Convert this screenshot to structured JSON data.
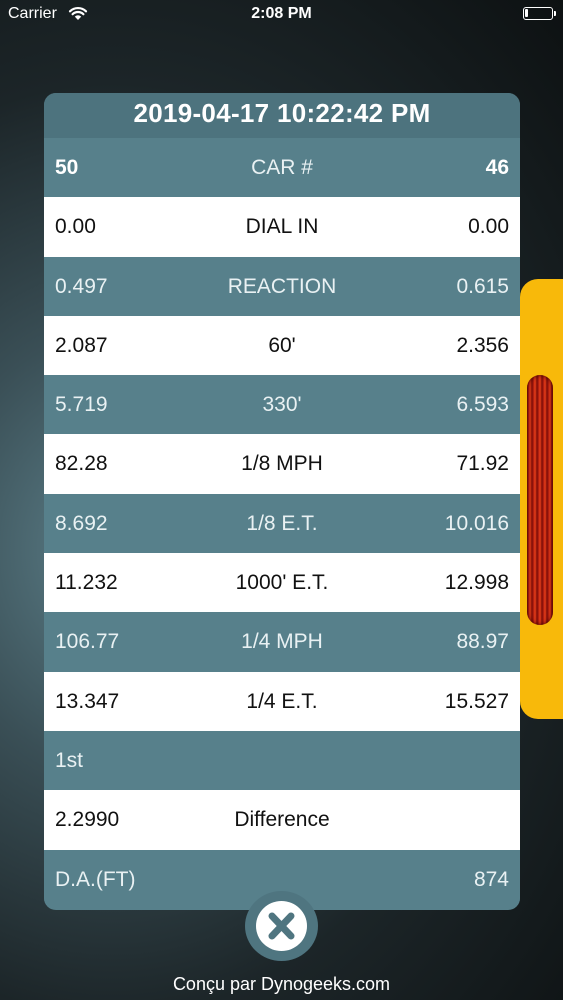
{
  "status_bar": {
    "carrier": "Carrier",
    "time": "2:08 PM"
  },
  "card": {
    "title": "2019-04-17 10:22:42 PM",
    "rows": [
      {
        "left": "50",
        "label": "CAR #",
        "right": "46",
        "style": "header"
      },
      {
        "left": "0.00",
        "label": "DIAL IN",
        "right": "0.00",
        "style": "light"
      },
      {
        "left": "0.497",
        "label": "REACTION",
        "right": "0.615",
        "style": "dark"
      },
      {
        "left": "2.087",
        "label": "60'",
        "right": "2.356",
        "style": "light"
      },
      {
        "left": "5.719",
        "label": "330'",
        "right": "6.593",
        "style": "dark"
      },
      {
        "left": "82.28",
        "label": "1/8 MPH",
        "right": "71.92",
        "style": "light"
      },
      {
        "left": "8.692",
        "label": "1/8 E.T.",
        "right": "10.016",
        "style": "dark"
      },
      {
        "left": "11.232",
        "label": "1000' E.T.",
        "right": "12.998",
        "style": "light"
      },
      {
        "left": "106.77",
        "label": "1/4 MPH",
        "right": "88.97",
        "style": "dark"
      },
      {
        "left": "13.347",
        "label": "1/4 E.T.",
        "right": "15.527",
        "style": "light"
      },
      {
        "left": "1st",
        "label": "",
        "right": "",
        "style": "dark"
      },
      {
        "left": "2.2990",
        "label": "Difference",
        "right": "",
        "style": "light"
      },
      {
        "left": "D.A.(FT)",
        "label": "",
        "right": "874",
        "style": "dark"
      }
    ]
  },
  "icons": {
    "close": "close-icon",
    "wifi": "wifi-icon",
    "battery": "battery-icon"
  },
  "colors": {
    "accent_tab": "#f8b90a",
    "row_dark": "#57808b",
    "row_light": "#ffffff",
    "close_x": "#4f7580"
  },
  "footer": {
    "credit": "Conçu par Dynogeeks.com"
  }
}
